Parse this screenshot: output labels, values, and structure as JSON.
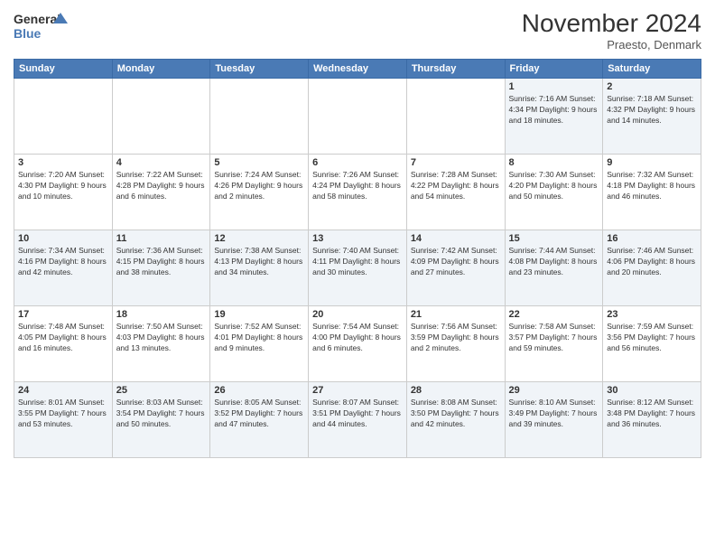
{
  "logo": {
    "line1": "General",
    "line2": "Blue"
  },
  "title": "November 2024",
  "subtitle": "Praesto, Denmark",
  "days_of_week": [
    "Sunday",
    "Monday",
    "Tuesday",
    "Wednesday",
    "Thursday",
    "Friday",
    "Saturday"
  ],
  "weeks": [
    [
      {
        "day": "",
        "info": ""
      },
      {
        "day": "",
        "info": ""
      },
      {
        "day": "",
        "info": ""
      },
      {
        "day": "",
        "info": ""
      },
      {
        "day": "",
        "info": ""
      },
      {
        "day": "1",
        "info": "Sunrise: 7:16 AM\nSunset: 4:34 PM\nDaylight: 9 hours\nand 18 minutes."
      },
      {
        "day": "2",
        "info": "Sunrise: 7:18 AM\nSunset: 4:32 PM\nDaylight: 9 hours\nand 14 minutes."
      }
    ],
    [
      {
        "day": "3",
        "info": "Sunrise: 7:20 AM\nSunset: 4:30 PM\nDaylight: 9 hours\nand 10 minutes."
      },
      {
        "day": "4",
        "info": "Sunrise: 7:22 AM\nSunset: 4:28 PM\nDaylight: 9 hours\nand 6 minutes."
      },
      {
        "day": "5",
        "info": "Sunrise: 7:24 AM\nSunset: 4:26 PM\nDaylight: 9 hours\nand 2 minutes."
      },
      {
        "day": "6",
        "info": "Sunrise: 7:26 AM\nSunset: 4:24 PM\nDaylight: 8 hours\nand 58 minutes."
      },
      {
        "day": "7",
        "info": "Sunrise: 7:28 AM\nSunset: 4:22 PM\nDaylight: 8 hours\nand 54 minutes."
      },
      {
        "day": "8",
        "info": "Sunrise: 7:30 AM\nSunset: 4:20 PM\nDaylight: 8 hours\nand 50 minutes."
      },
      {
        "day": "9",
        "info": "Sunrise: 7:32 AM\nSunset: 4:18 PM\nDaylight: 8 hours\nand 46 minutes."
      }
    ],
    [
      {
        "day": "10",
        "info": "Sunrise: 7:34 AM\nSunset: 4:16 PM\nDaylight: 8 hours\nand 42 minutes."
      },
      {
        "day": "11",
        "info": "Sunrise: 7:36 AM\nSunset: 4:15 PM\nDaylight: 8 hours\nand 38 minutes."
      },
      {
        "day": "12",
        "info": "Sunrise: 7:38 AM\nSunset: 4:13 PM\nDaylight: 8 hours\nand 34 minutes."
      },
      {
        "day": "13",
        "info": "Sunrise: 7:40 AM\nSunset: 4:11 PM\nDaylight: 8 hours\nand 30 minutes."
      },
      {
        "day": "14",
        "info": "Sunrise: 7:42 AM\nSunset: 4:09 PM\nDaylight: 8 hours\nand 27 minutes."
      },
      {
        "day": "15",
        "info": "Sunrise: 7:44 AM\nSunset: 4:08 PM\nDaylight: 8 hours\nand 23 minutes."
      },
      {
        "day": "16",
        "info": "Sunrise: 7:46 AM\nSunset: 4:06 PM\nDaylight: 8 hours\nand 20 minutes."
      }
    ],
    [
      {
        "day": "17",
        "info": "Sunrise: 7:48 AM\nSunset: 4:05 PM\nDaylight: 8 hours\nand 16 minutes."
      },
      {
        "day": "18",
        "info": "Sunrise: 7:50 AM\nSunset: 4:03 PM\nDaylight: 8 hours\nand 13 minutes."
      },
      {
        "day": "19",
        "info": "Sunrise: 7:52 AM\nSunset: 4:01 PM\nDaylight: 8 hours\nand 9 minutes."
      },
      {
        "day": "20",
        "info": "Sunrise: 7:54 AM\nSunset: 4:00 PM\nDaylight: 8 hours\nand 6 minutes."
      },
      {
        "day": "21",
        "info": "Sunrise: 7:56 AM\nSunset: 3:59 PM\nDaylight: 8 hours\nand 2 minutes."
      },
      {
        "day": "22",
        "info": "Sunrise: 7:58 AM\nSunset: 3:57 PM\nDaylight: 7 hours\nand 59 minutes."
      },
      {
        "day": "23",
        "info": "Sunrise: 7:59 AM\nSunset: 3:56 PM\nDaylight: 7 hours\nand 56 minutes."
      }
    ],
    [
      {
        "day": "24",
        "info": "Sunrise: 8:01 AM\nSunset: 3:55 PM\nDaylight: 7 hours\nand 53 minutes."
      },
      {
        "day": "25",
        "info": "Sunrise: 8:03 AM\nSunset: 3:54 PM\nDaylight: 7 hours\nand 50 minutes."
      },
      {
        "day": "26",
        "info": "Sunrise: 8:05 AM\nSunset: 3:52 PM\nDaylight: 7 hours\nand 47 minutes."
      },
      {
        "day": "27",
        "info": "Sunrise: 8:07 AM\nSunset: 3:51 PM\nDaylight: 7 hours\nand 44 minutes."
      },
      {
        "day": "28",
        "info": "Sunrise: 8:08 AM\nSunset: 3:50 PM\nDaylight: 7 hours\nand 42 minutes."
      },
      {
        "day": "29",
        "info": "Sunrise: 8:10 AM\nSunset: 3:49 PM\nDaylight: 7 hours\nand 39 minutes."
      },
      {
        "day": "30",
        "info": "Sunrise: 8:12 AM\nSunset: 3:48 PM\nDaylight: 7 hours\nand 36 minutes."
      }
    ]
  ]
}
